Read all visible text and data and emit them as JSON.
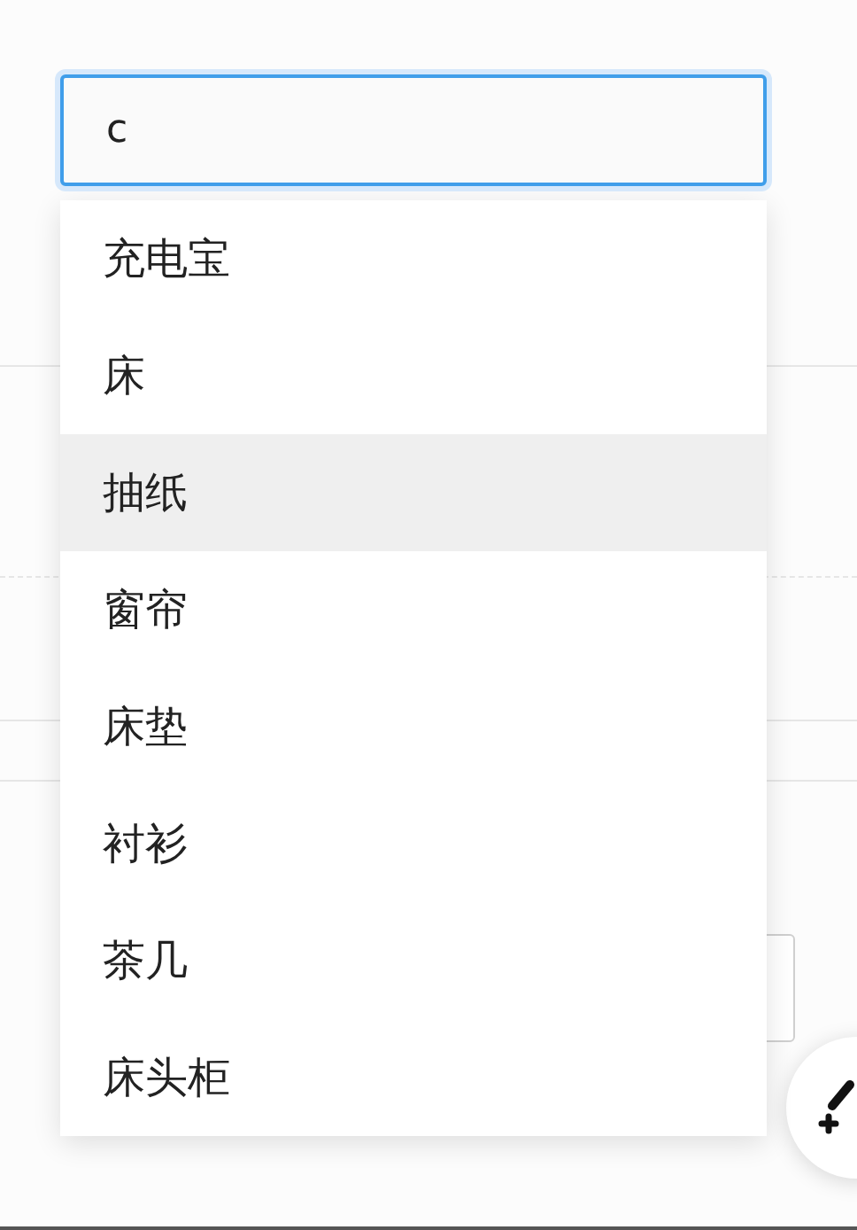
{
  "search": {
    "value": "c",
    "focused": true
  },
  "suggestions": [
    {
      "label": "充电宝",
      "selected": false
    },
    {
      "label": "床",
      "selected": false
    },
    {
      "label": "抽纸",
      "selected": true
    },
    {
      "label": "窗帘",
      "selected": false
    },
    {
      "label": "床垫",
      "selected": false
    },
    {
      "label": "衬衫",
      "selected": false
    },
    {
      "label": "茶几",
      "selected": false
    },
    {
      "label": "床头柜",
      "selected": false
    }
  ]
}
